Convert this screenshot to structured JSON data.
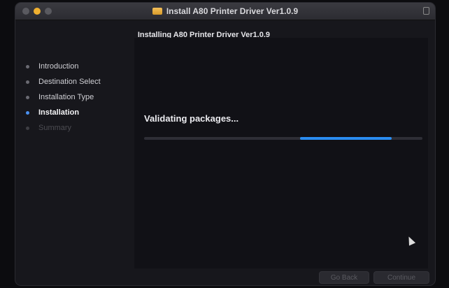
{
  "window": {
    "title": "Install A80 Printer Driver Ver1.0.9",
    "header": "Installing A80 Printer Driver Ver1.0.9"
  },
  "sidebar": {
    "steps": [
      {
        "label": "Introduction",
        "state": "done"
      },
      {
        "label": "Destination Select",
        "state": "done"
      },
      {
        "label": "Installation Type",
        "state": "done"
      },
      {
        "label": "Installation",
        "state": "active"
      },
      {
        "label": "Summary",
        "state": "pending"
      }
    ]
  },
  "main": {
    "status": "Validating packages...",
    "progress": {
      "start": 0.56,
      "end": 0.89,
      "indeterminate": true,
      "color": "#2a8cf0"
    }
  },
  "buttons": {
    "back_label": "Go Back",
    "continue_label": "Continue"
  },
  "icons": {
    "title_icon": "package-icon",
    "lock": "lock-icon"
  }
}
